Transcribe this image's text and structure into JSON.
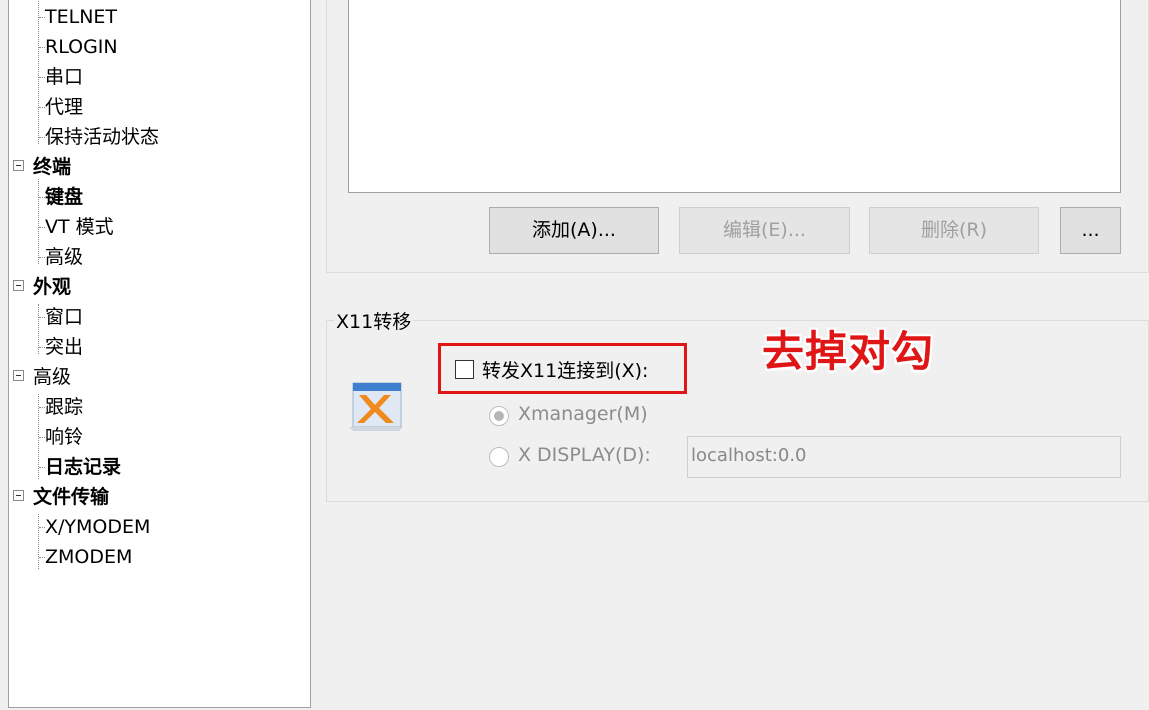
{
  "tree": {
    "items": [
      {
        "label": "TELNET"
      },
      {
        "label": "RLOGIN"
      },
      {
        "label": "串口"
      },
      {
        "label": "代理"
      },
      {
        "label": "保持活动状态"
      },
      {
        "label": "终端"
      },
      {
        "label": "键盘"
      },
      {
        "label": "VT 模式"
      },
      {
        "label": "高级"
      },
      {
        "label": "外观"
      },
      {
        "label": "窗口"
      },
      {
        "label": "突出"
      },
      {
        "label": "高级"
      },
      {
        "label": "跟踪"
      },
      {
        "label": "响铃"
      },
      {
        "label": "日志记录"
      },
      {
        "label": "文件传输"
      },
      {
        "label": "X/YMODEM"
      },
      {
        "label": "ZMODEM"
      }
    ]
  },
  "buttons": {
    "add": "添加(A)...",
    "edit": "编辑(E)...",
    "delete": "删除(R)",
    "more": "..."
  },
  "x11": {
    "title": "X11转移",
    "forward_label": "转发X11连接到(X):",
    "forward_checked": false,
    "options": [
      {
        "label": "Xmanager(M)",
        "selected": true
      },
      {
        "label": "X DISPLAY(D):",
        "selected": false
      }
    ],
    "display_value": "localhost:0.0"
  },
  "annotation": {
    "text": "去掉对勾",
    "color": "#e01515"
  },
  "icons": {
    "xmanager": "xmanager-x-icon"
  }
}
